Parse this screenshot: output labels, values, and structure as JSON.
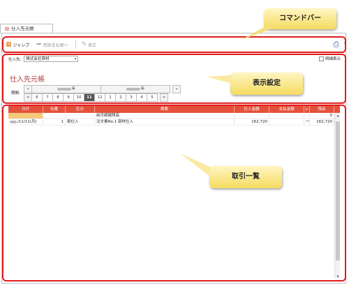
{
  "tab": {
    "label": "仕入先元帳"
  },
  "commandbar": {
    "jump_label": "ジャンプ",
    "payment_label": "買掛支払帳へ",
    "fix_label": "修正"
  },
  "settings": {
    "supplier_label": "仕入先:",
    "supplier_value": "株式会社資材",
    "detail_label": "明細表示",
    "title": "仕入先元帳",
    "period_label": "期間:",
    "nav_prev": "«",
    "nav_next": "»",
    "month_prev": "<",
    "month_next": ">",
    "year_suffix": "年",
    "months": [
      "6",
      "7",
      "8",
      "9",
      "10",
      "11",
      "12",
      "1",
      "2",
      "3",
      "4",
      "5"
    ],
    "selected_month": "11"
  },
  "table": {
    "headers": [
      "日付",
      "伝番",
      "区分",
      "摘要",
      "仕入金額",
      "支払金額",
      "レ",
      "残高"
    ],
    "rows": [
      {
        "date": "",
        "voucher": "",
        "kind": "",
        "summary": "前月締越残高",
        "in": "",
        "out": "",
        "re": "",
        "balance": "0"
      },
      {
        "date": "/11/11(月)",
        "voucher": "1",
        "kind": "掛仕入",
        "summary": "注文書No.1 部材仕入",
        "in": "162,720",
        "out": "",
        "re": "ー",
        "balance": "162,720"
      }
    ]
  },
  "annotations": {
    "command_bar": "コマンドバー",
    "display_settings": "表示設定",
    "transactions": "取引一覧"
  },
  "colors": {
    "accent": "#e4513b",
    "annotation_box": "#e11b1b",
    "title": "#b03a3a"
  }
}
